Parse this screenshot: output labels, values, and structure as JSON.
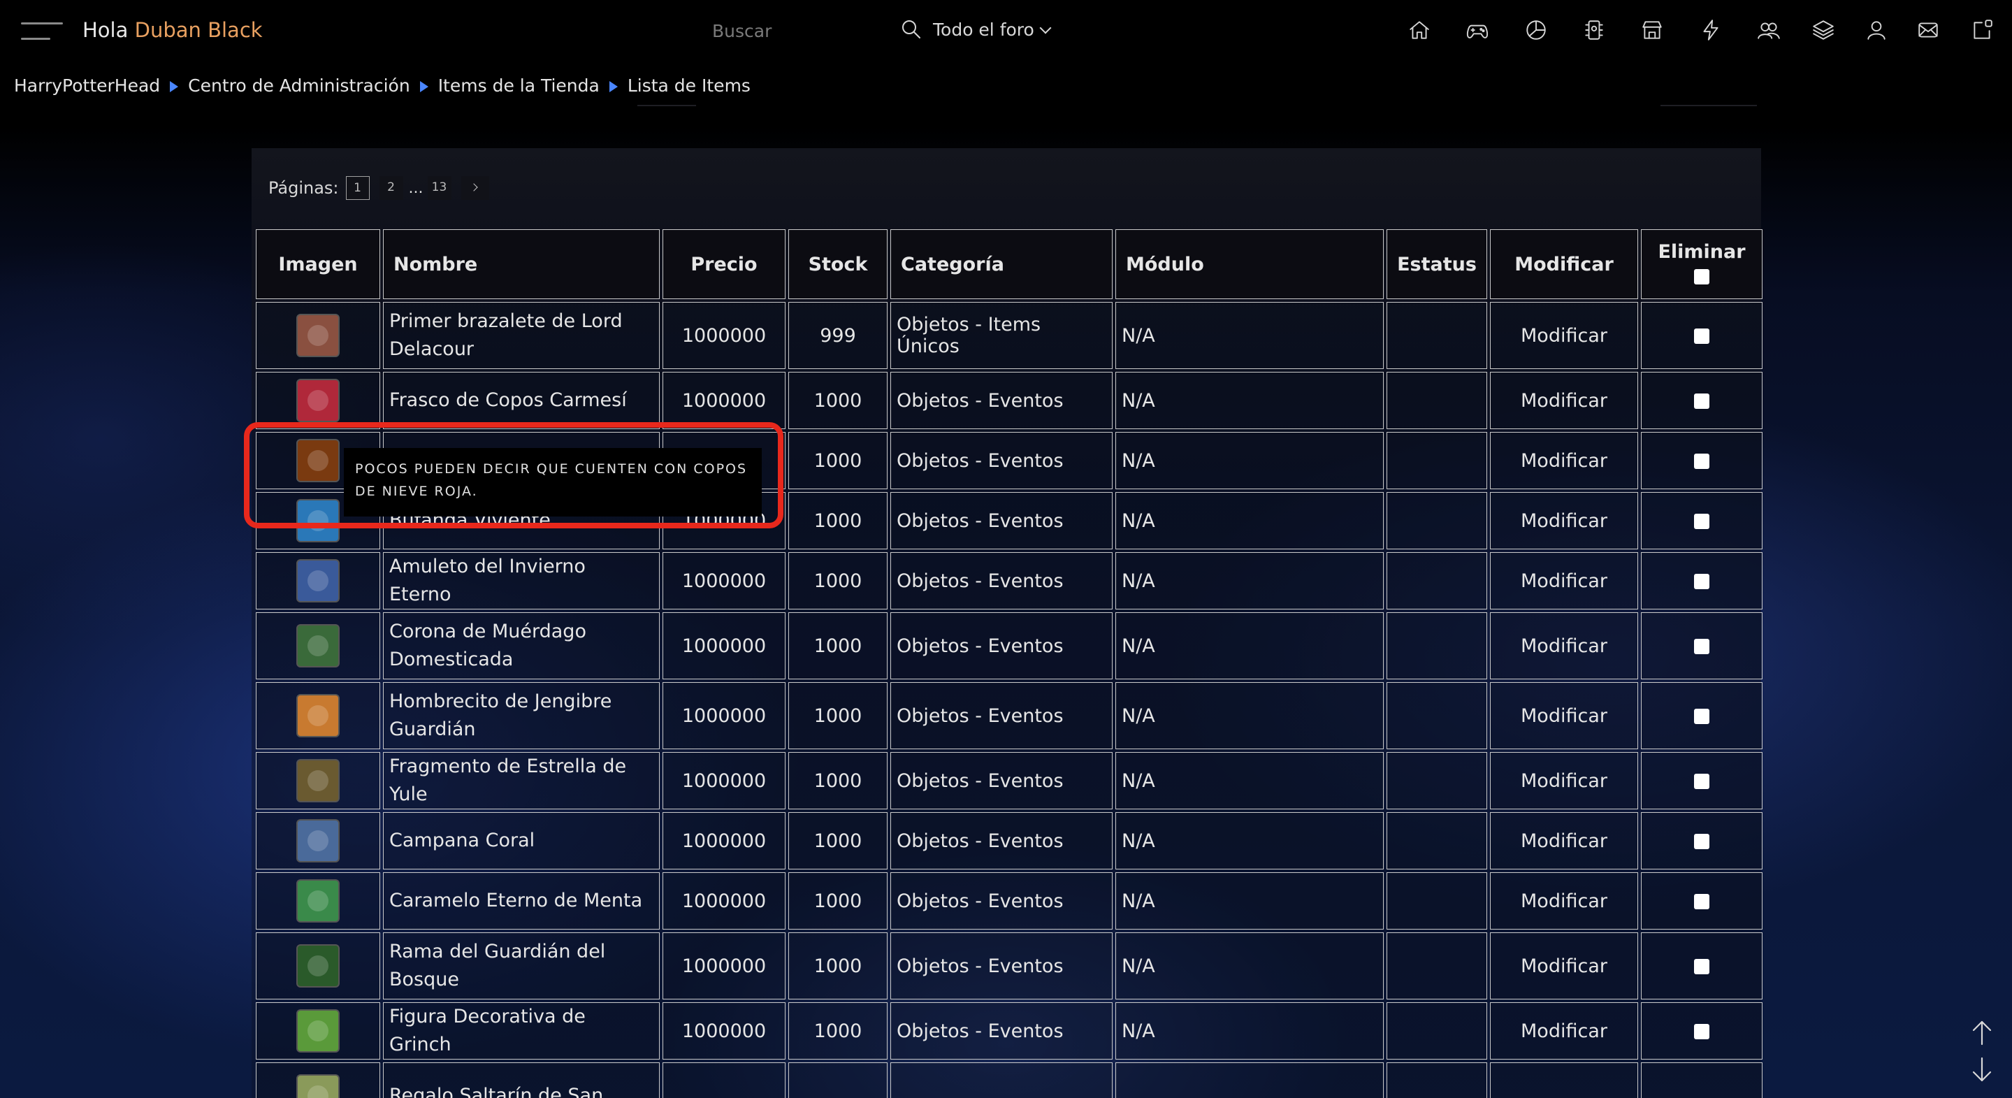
{
  "header": {
    "greeting_prefix": "Hola",
    "username": "Duban Black",
    "search_placeholder": "Buscar",
    "search_scope": "Todo el foro"
  },
  "nav_icons": [
    "home-icon",
    "gamepad-icon",
    "pie-chart-icon",
    "trophy-icon",
    "store-icon",
    "lightning-icon",
    "users-icon",
    "layers-icon",
    "user-icon",
    "mail-icon",
    "notifications-icon"
  ],
  "breadcrumb": [
    "HarryPotterHead",
    "Centro de Administración",
    "Items de la Tienda",
    "Lista de Items"
  ],
  "pagination": {
    "label": "Páginas:",
    "pages": [
      "1",
      "2",
      "13"
    ],
    "ellipsis": "...",
    "current": "1"
  },
  "table": {
    "headers": {
      "imagen": "Imagen",
      "nombre": "Nombre",
      "precio": "Precio",
      "stock": "Stock",
      "categoria": "Categoría",
      "modulo": "Módulo",
      "estatus": "Estatus",
      "modificar": "Modificar",
      "eliminar": "Eliminar"
    },
    "rows": [
      {
        "nombre": "Primer brazalete de Lord Delacour",
        "precio": "1000000",
        "stock": "999",
        "categoria": "Objetos - Items Únicos",
        "modulo": "N/A",
        "estatus": "",
        "modificar": "Modificar",
        "thumb_color": "#8a5040"
      },
      {
        "nombre": "Frasco de Copos Carmesí",
        "precio": "1000000",
        "stock": "1000",
        "categoria": "Objetos - Eventos",
        "modulo": "N/A",
        "estatus": "",
        "modificar": "Modificar",
        "thumb_color": "#b0283a"
      },
      {
        "nombre": "",
        "precio": "",
        "stock": "1000",
        "categoria": "Objetos - Eventos",
        "modulo": "N/A",
        "estatus": "",
        "modificar": "Modificar",
        "thumb_color": "#7a3a10"
      },
      {
        "nombre": "Bufanda Viviente",
        "precio": "1000000",
        "stock": "1000",
        "categoria": "Objetos - Eventos",
        "modulo": "N/A",
        "estatus": "",
        "modificar": "Modificar",
        "thumb_color": "#2a78b8"
      },
      {
        "nombre": "Amuleto del Invierno Eterno",
        "precio": "1000000",
        "stock": "1000",
        "categoria": "Objetos - Eventos",
        "modulo": "N/A",
        "estatus": "",
        "modificar": "Modificar",
        "thumb_color": "#3a5a9a"
      },
      {
        "nombre": "Corona de Muérdago Domesticada",
        "precio": "1000000",
        "stock": "1000",
        "categoria": "Objetos - Eventos",
        "modulo": "N/A",
        "estatus": "",
        "modificar": "Modificar",
        "thumb_color": "#3a6a3a"
      },
      {
        "nombre": "Hombrecito de Jengibre Guardián",
        "precio": "1000000",
        "stock": "1000",
        "categoria": "Objetos - Eventos",
        "modulo": "N/A",
        "estatus": "",
        "modificar": "Modificar",
        "thumb_color": "#c87a30"
      },
      {
        "nombre": "Fragmento de Estrella de Yule",
        "precio": "1000000",
        "stock": "1000",
        "categoria": "Objetos - Eventos",
        "modulo": "N/A",
        "estatus": "",
        "modificar": "Modificar",
        "thumb_color": "#6a5a30"
      },
      {
        "nombre": "Campana Coral",
        "precio": "1000000",
        "stock": "1000",
        "categoria": "Objetos - Eventos",
        "modulo": "N/A",
        "estatus": "",
        "modificar": "Modificar",
        "thumb_color": "#4a6a9a"
      },
      {
        "nombre": "Caramelo Eterno de Menta",
        "precio": "1000000",
        "stock": "1000",
        "categoria": "Objetos - Eventos",
        "modulo": "N/A",
        "estatus": "",
        "modificar": "Modificar",
        "thumb_color": "#3a8a4a"
      },
      {
        "nombre": "Rama del Guardián del Bosque",
        "precio": "1000000",
        "stock": "1000",
        "categoria": "Objetos - Eventos",
        "modulo": "N/A",
        "estatus": "",
        "modificar": "Modificar",
        "thumb_color": "#2a5a2a"
      },
      {
        "nombre": "Figura Decorativa de Grinch",
        "precio": "1000000",
        "stock": "1000",
        "categoria": "Objetos - Eventos",
        "modulo": "N/A",
        "estatus": "",
        "modificar": "Modificar",
        "thumb_color": "#5a9a3a"
      },
      {
        "nombre": "Regalo Saltarín de San",
        "precio": "",
        "stock": "",
        "categoria": "",
        "modulo": "",
        "estatus": "",
        "modificar": "",
        "thumb_color": "#8a9a5a"
      }
    ]
  },
  "tooltip": {
    "text": "Pocos pueden decir que cuenten con copos de nieve roja."
  },
  "colors": {
    "accent_username": "#e8a060",
    "breadcrumb_separator": "#4a86ff",
    "highlight_box": "#e8281c"
  }
}
